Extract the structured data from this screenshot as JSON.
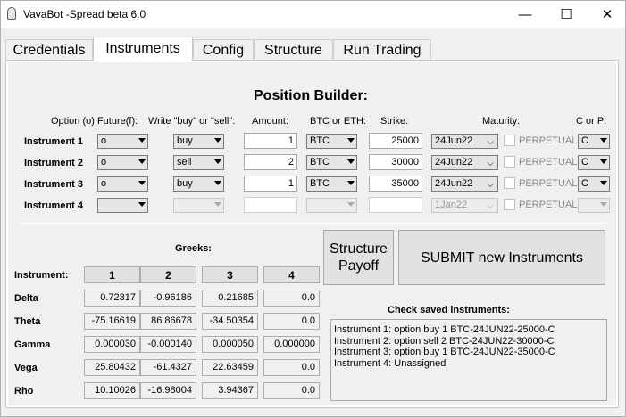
{
  "window": {
    "title": "VavaBot -Spread beta 6.0",
    "minimize": "—",
    "maximize": "☐",
    "close": "✕"
  },
  "tabs": [
    "Credentials",
    "Instruments",
    "Config",
    "Structure",
    "Run Trading"
  ],
  "builder": {
    "heading": "Position Builder:",
    "col_option": "Option (o) Future(f):",
    "col_write": "Write \"buy\" or \"sell\":",
    "col_amount": "Amount:",
    "col_currency": "BTC or ETH:",
    "col_strike": "Strike:",
    "col_maturity": "Maturity:",
    "col_cp": "C or P:",
    "perpetual_label": "PERPETUAL",
    "rows": [
      {
        "label": "Instrument 1",
        "type": "o",
        "side": "buy",
        "amount": "1",
        "currency": "BTC",
        "strike": "25000",
        "maturity": "24Jun22",
        "cp": "C"
      },
      {
        "label": "Instrument 2",
        "type": "o",
        "side": "sell",
        "amount": "2",
        "currency": "BTC",
        "strike": "30000",
        "maturity": "24Jun22",
        "cp": "C"
      },
      {
        "label": "Instrument 3",
        "type": "o",
        "side": "buy",
        "amount": "1",
        "currency": "BTC",
        "strike": "35000",
        "maturity": "24Jun22",
        "cp": "C"
      },
      {
        "label": "Instrument 4",
        "type": "",
        "side": "",
        "amount": "",
        "currency": "",
        "strike": "",
        "maturity": "1Jan22",
        "cp": ""
      }
    ]
  },
  "greeks": {
    "heading": "Greeks:",
    "instrument_label": "Instrument:",
    "columns": [
      "1",
      "2",
      "3",
      "4"
    ],
    "rows": [
      {
        "name": "Delta",
        "values": [
          "0.72317",
          "-0.96186",
          "0.21685",
          "0.0"
        ]
      },
      {
        "name": "Theta",
        "values": [
          "-75.16619",
          "86.86678",
          "-34.50354",
          "0.0"
        ]
      },
      {
        "name": "Gamma",
        "values": [
          "0.000030",
          "-0.000140",
          "0.000050",
          "0.000000"
        ]
      },
      {
        "name": "Vega",
        "values": [
          "25.80432",
          "-61.4327",
          "22.63459",
          "0.0"
        ]
      },
      {
        "name": "Rho",
        "values": [
          "10.10026",
          "-16.98004",
          "3.94367",
          "0.0"
        ]
      }
    ]
  },
  "buttons": {
    "structure_payoff_line1": "Structure",
    "structure_payoff_line2": "Payoff",
    "submit": "SUBMIT new Instruments"
  },
  "saved": {
    "heading": "Check saved instruments:",
    "lines": [
      "Instrument 1: option buy 1 BTC-24JUN22-25000-C",
      "Instrument 2: option sell 2 BTC-24JUN22-30000-C",
      "Instrument 3: option buy 1 BTC-24JUN22-35000-C",
      "Instrument 4: Unassigned"
    ]
  }
}
